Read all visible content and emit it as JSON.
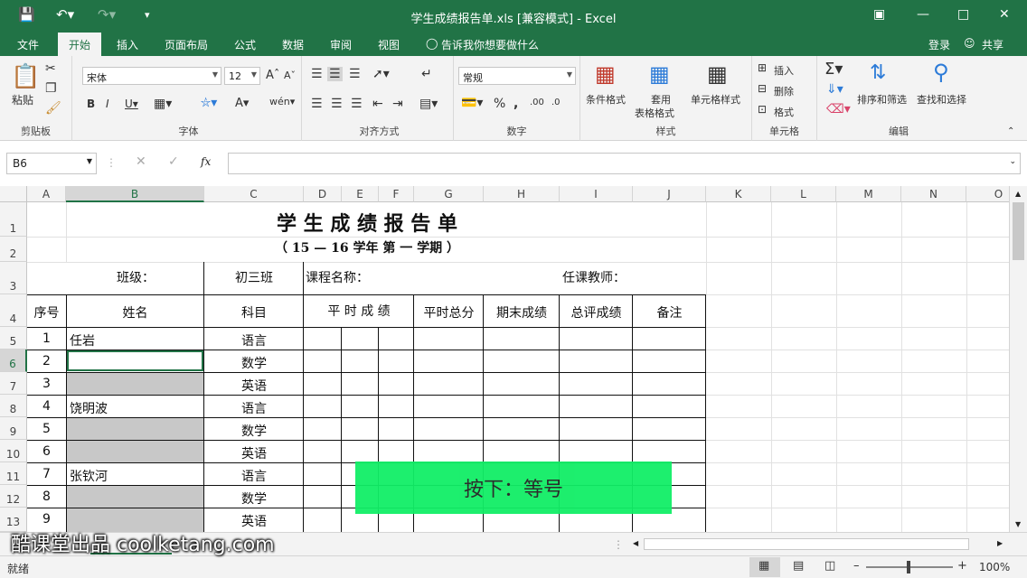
{
  "titlebar": {
    "title": "学生成绩报告单.xls  [兼容模式] - Excel",
    "colors": {
      "brand": "#217346"
    }
  },
  "tabs": {
    "items": [
      "文件",
      "开始",
      "插入",
      "页面布局",
      "公式",
      "数据",
      "审阅",
      "视图"
    ],
    "tell_me": "告诉我你想要做什么",
    "signin": "登录",
    "share": "共享"
  },
  "ribbon": {
    "clipboard": {
      "label": "剪贴板",
      "paste": "粘贴"
    },
    "font": {
      "label": "字体",
      "name": "宋体",
      "size": "12"
    },
    "alignment": {
      "label": "对齐方式"
    },
    "number": {
      "label": "数字",
      "format": "常规"
    },
    "styles": {
      "label": "样式",
      "conditional": "条件格式",
      "table_line1": "套用",
      "table_line2": "表格格式",
      "cell_styles": "单元格样式"
    },
    "cells": {
      "label": "单元格",
      "insert": "插入",
      "delete": "删除",
      "format": "格式"
    },
    "editing": {
      "label": "编辑",
      "sort": "排序和筛选",
      "find": "查找和选择"
    }
  },
  "formula_bar": {
    "name_box": "B6",
    "fx": "fx",
    "formula": ""
  },
  "columns": [
    "A",
    "B",
    "C",
    "D",
    "E",
    "F",
    "G",
    "H",
    "I",
    "J",
    "K",
    "L",
    "M",
    "N",
    "O"
  ],
  "rows": [
    "1",
    "2",
    "3",
    "4",
    "5",
    "6",
    "7",
    "8",
    "9",
    "10",
    "11",
    "12",
    "13"
  ],
  "sheet": {
    "title": "学 生 成 绩 报 告 单",
    "subtitle": "（ 15 — 16    学年 第 一 学期 ）",
    "class_label": "班级：",
    "class_value": "初三班",
    "course_label": "课程名称：",
    "teacher_label": "任课教师：",
    "headers": {
      "seq": "序号",
      "name": "姓名",
      "subject": "科目",
      "usual": "平 时 成 绩",
      "usual_total": "平时总分",
      "final": "期末成绩",
      "overall": "总评成绩",
      "note": "备注"
    },
    "students": [
      {
        "seq": "1",
        "name": "任岩",
        "subject": "语言"
      },
      {
        "seq": "2",
        "name": "",
        "subject": "数学"
      },
      {
        "seq": "3",
        "name": "",
        "subject": "英语"
      },
      {
        "seq": "4",
        "name": "饶明波",
        "subject": "语言"
      },
      {
        "seq": "5",
        "name": "",
        "subject": "数学"
      },
      {
        "seq": "6",
        "name": "",
        "subject": "英语"
      },
      {
        "seq": "7",
        "name": "张钦河",
        "subject": "语言"
      },
      {
        "seq": "8",
        "name": "",
        "subject": "数学"
      },
      {
        "seq": "9",
        "name": "",
        "subject": "英语"
      }
    ]
  },
  "status": {
    "ready": "就绪",
    "zoom": "100%"
  },
  "overlay": {
    "banner": "按下：等号",
    "watermark": "酷课堂出品 coolketang.com"
  }
}
